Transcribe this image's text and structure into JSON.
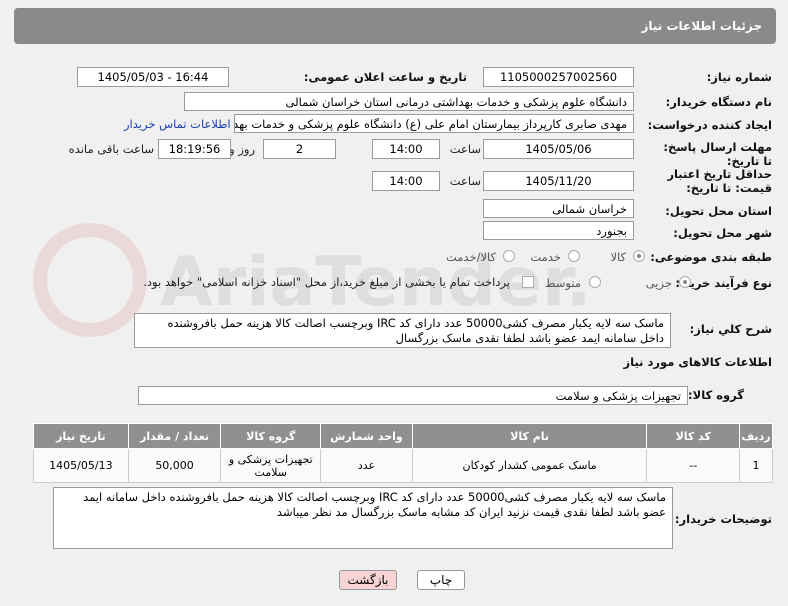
{
  "header": {
    "title": "جزئیات اطلاعات نیاز"
  },
  "fields": {
    "need_number_label": "شماره نیاز:",
    "need_number": "1105000257002560",
    "announce_label": "تاریخ و ساعت اعلان عمومی:",
    "announce_value": "1405/05/03 - 16:44",
    "buyer_org_label": "نام دستگاه خریدار:",
    "buyer_org": "دانشگاه علوم پزشکی و خدمات بهداشتی درمانی استان خراسان شمالی",
    "requester_label": "ایجاد کننده درخواست:",
    "requester": "مهدی صابری کارپرداز بیمارستان امام علی (ع) دانشگاه علوم پزشکی و خدمات بهداشتی درمانی استان خراسان شمالی",
    "contact_link": "اطلاعات تماس خریدار",
    "deadline_label": "مهلت ارسال پاسخ: تا تاریخ:",
    "deadline_date": "1405/05/06",
    "time_label": "ساعت",
    "deadline_time": "14:00",
    "days_value": "2",
    "days_label": "روز و",
    "remaining_time": "18:19:56",
    "remaining_label": "ساعت باقی مانده",
    "validity_label": "حداقل تاریخ اعتبار قیمت: تا تاریخ:",
    "validity_date": "1405/11/20",
    "validity_time": "14:00",
    "province_label": "استان محل تحویل:",
    "province": "خراسان شمالی",
    "city_label": "شهر محل تحویل:",
    "city": "بجنورد",
    "category_label": "طبقه بندی موضوعی:",
    "category_options": [
      "کالا",
      "خدمت",
      "کالا/خدمت"
    ],
    "process_label": "نوع فرآیند خرید :",
    "process_options": [
      "جزیی",
      "متوسط"
    ],
    "payment_note": "پرداخت تمام یا بخشی از مبلغ خرید،از محل \"اسناد خزانه اسلامی\" خواهد بود."
  },
  "description": {
    "label": "شرح کلي نياز:",
    "text": "ماسک سه لایه یکبار مصرف کشی50000 عدد دارای کد IRC وبرچسب اصالت کالا هزینه حمل بافروشنده داخل سامانه ایمد عضو باشد لطفا نقدی ماسک بزرگسال"
  },
  "goods_section": {
    "title": "اطلاعات کالاهای مورد نیاز",
    "group_label": "گروه کالا:",
    "group_value": "تجهیزات پزشکی و سلامت"
  },
  "table": {
    "headers": [
      "ردیف",
      "کد کالا",
      "نام کالا",
      "واحد شمارش",
      "گروه کالا",
      "تعداد / مقدار",
      "تاریخ نیاز"
    ],
    "rows": [
      [
        "1",
        "--",
        "ماسک عمومی کشدار کودکان",
        "عدد",
        "تجهیزات پزشکی و سلامت",
        "50,000",
        "1405/05/13"
      ]
    ]
  },
  "buyer_notes": {
    "label": "توضیحات خریدار:",
    "text": "ماسک سه لایه یکبار مصرف کشی50000 عدد دارای کد IRC وبرچسب اصالت کالا هزینه حمل بافروشنده داخل سامانه ایمد عضو باشد لطفا نقدی قیمت نزنید   ایران کد مشابه  ماسک بزرگسال مد نظر میباشد"
  },
  "buttons": {
    "print": "چاپ",
    "back": "بازگشت"
  },
  "watermark": "AriaTender.net",
  "colors": {
    "header": "#8a8a8a",
    "link": "#1a3fae",
    "back_button": "#f7d3d3",
    "print_button": "#ffffff"
  }
}
